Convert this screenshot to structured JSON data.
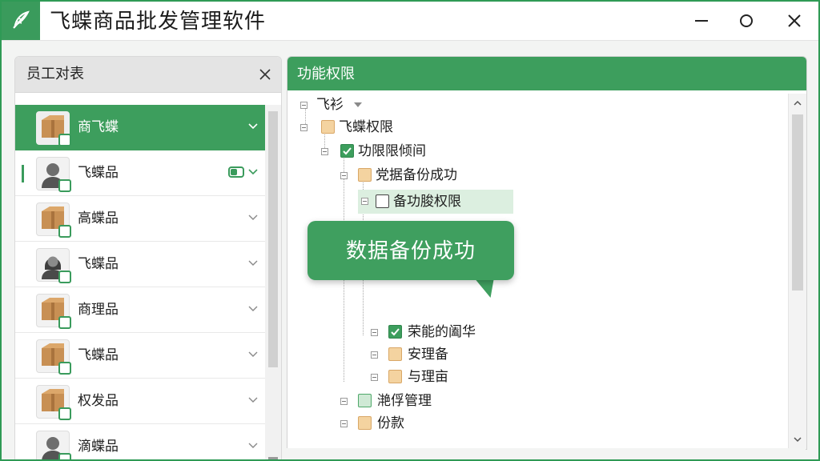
{
  "app": {
    "title": "飞蝶商品批发管理软件",
    "logo_icon": "feather-logo-icon",
    "accent_color": "#3d9e5d"
  },
  "window_controls": {
    "minimize": "minimize-icon",
    "maximize": "maximize-icon",
    "close": "close-icon"
  },
  "employee_panel": {
    "title": "员工对表",
    "items": [
      {
        "name": "商飞蝶",
        "avatar": "package-avatar",
        "selected": true
      },
      {
        "name": "飞蝶品",
        "avatar": "man-avatar",
        "badge": "toggle-icon"
      },
      {
        "name": "高蝶品",
        "avatar": "package-avatar"
      },
      {
        "name": "飞蝶品",
        "avatar": "woman-avatar"
      },
      {
        "name": "商理品",
        "avatar": "package-avatar"
      },
      {
        "name": "飞蝶品",
        "avatar": "package-avatar"
      },
      {
        "name": "权发品",
        "avatar": "package-avatar"
      },
      {
        "name": "滴蝶品",
        "avatar": "man-avatar"
      }
    ]
  },
  "permission_panel": {
    "title": "功能权限",
    "tree": [
      {
        "label": "飞衫",
        "checkbox": "none",
        "level": 0
      },
      {
        "label": "飞蝶权限",
        "checkbox": "tan",
        "level": 0
      },
      {
        "label": "功限限倾间",
        "checkbox": "green",
        "level": 1
      },
      {
        "label": "党据备份成功",
        "checkbox": "tan",
        "level": 2
      },
      {
        "label": "备功朘权限",
        "checkbox": "empty",
        "level": 3
      },
      {
        "label": "荣能的阖华",
        "checkbox": "green",
        "level": 3
      },
      {
        "label": "安理备",
        "checkbox": "tan",
        "level": 3
      },
      {
        "label": "与理亩",
        "checkbox": "tan",
        "level": 3
      },
      {
        "label": "滟俘管理",
        "checkbox": "lightgreen",
        "level": 2
      },
      {
        "label": "份款",
        "checkbox": "tan",
        "level": 2
      }
    ]
  },
  "tooltip": {
    "text": "数据备份成功"
  }
}
